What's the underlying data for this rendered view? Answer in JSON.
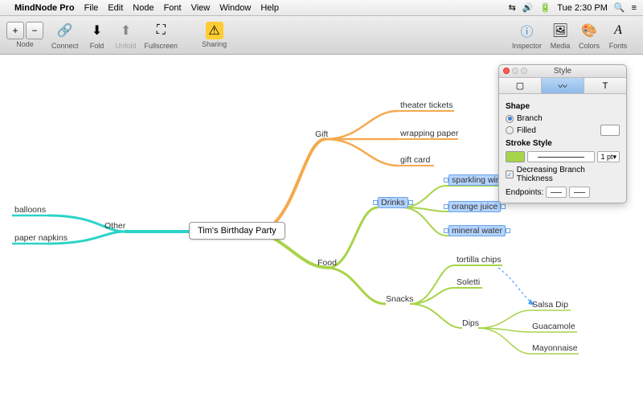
{
  "menubar": {
    "app": "MindNode Pro",
    "items": [
      "File",
      "Edit",
      "Node",
      "Font",
      "View",
      "Window",
      "Help"
    ],
    "clock": "Tue 2:30 PM"
  },
  "toolbar": {
    "node_plus": "+",
    "node_minus": "−",
    "node_label": "Node",
    "connect_label": "Connect",
    "fold_label": "Fold",
    "unfold_label": "Unfold",
    "fullscreen_label": "Fullscreen",
    "sharing_label": "Sharing",
    "inspector_label": "Inspector",
    "media_label": "Media",
    "colors_label": "Colors",
    "fonts_label": "Fonts"
  },
  "mindmap": {
    "root": "Tim's Birthday Party",
    "other": {
      "label": "Other",
      "children": [
        "balloons",
        "paper napkins"
      ]
    },
    "gift": {
      "label": "Gift",
      "children": [
        "theater tickets",
        "wrapping paper",
        "gift card"
      ]
    },
    "food": {
      "label": "Food",
      "drinks": {
        "label": "Drinks",
        "children": [
          "sparkling wine",
          "orange juice",
          "mineral water"
        ]
      },
      "snacks": {
        "label": "Snacks",
        "children": [
          "tortilla chips",
          "Soletti"
        ],
        "dips": {
          "label": "Dips",
          "children": [
            "Salsa Dip",
            "Guacamole",
            "Mayonnaise"
          ]
        }
      }
    },
    "colors": {
      "other": "#2bd3c7",
      "gift": "#f5a94e",
      "food": "#a8d44a",
      "connection": "#4da3ff"
    }
  },
  "style_panel": {
    "title": "Style",
    "shape_title": "Shape",
    "branch_label": "Branch",
    "filled_label": "Filled",
    "stroke_title": "Stroke Style",
    "pt_label": "1 pt",
    "decreasing_label": "Decreasing Branch Thickness",
    "endpoints_label": "Endpoints:",
    "swatch_color": "#a8d44a"
  }
}
